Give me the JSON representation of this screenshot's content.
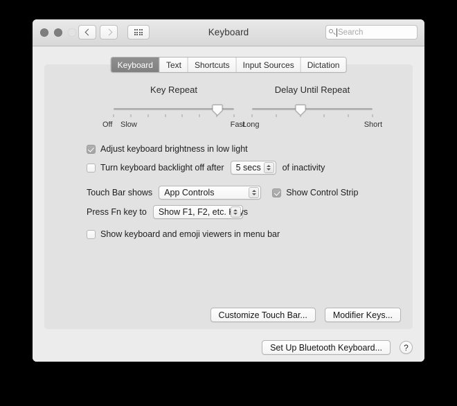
{
  "window": {
    "title": "Keyboard",
    "traffic_lights": [
      "close",
      "minimize",
      "zoom"
    ],
    "nav": {
      "back": "back-chevron",
      "forward": "forward-chevron",
      "show_all": "grid-icon"
    },
    "search": {
      "placeholder": "Search",
      "value": "",
      "icon": "search-icon"
    }
  },
  "tabs": [
    {
      "label": "Keyboard",
      "active": true
    },
    {
      "label": "Text",
      "active": false
    },
    {
      "label": "Shortcuts",
      "active": false
    },
    {
      "label": "Input Sources",
      "active": false
    },
    {
      "label": "Dictation",
      "active": false
    }
  ],
  "sliders": [
    {
      "title": "Key Repeat",
      "left_label": "Off",
      "second_label": "Slow",
      "right_label": "Fast",
      "ticks": 8,
      "value_percent": 86
    },
    {
      "title": "Delay Until Repeat",
      "left_label": "Long",
      "right_label": "Short",
      "ticks": 6,
      "value_percent": 40
    }
  ],
  "options": {
    "adjust_brightness": {
      "label": "Adjust keyboard brightness in low light",
      "checked": true
    },
    "backlight_off": {
      "label": "Turn keyboard backlight off after",
      "checked": false,
      "value": "5 secs",
      "suffix": "of inactivity"
    },
    "touch_bar_shows": {
      "label": "Touch Bar shows",
      "value": "App Controls"
    },
    "show_control_strip": {
      "label": "Show Control Strip",
      "checked": true
    },
    "press_fn_key": {
      "label": "Press Fn key to",
      "value": "Show F1, F2, etc. Keys"
    },
    "show_viewers": {
      "label": "Show keyboard and emoji viewers in menu bar",
      "checked": false
    }
  },
  "buttons": {
    "customize_touch_bar": "Customize Touch Bar...",
    "modifier_keys": "Modifier Keys...",
    "setup_bluetooth": "Set Up Bluetooth Keyboard...",
    "help": "?"
  },
  "colors": {
    "window_bg": "#ececec",
    "panel_bg": "#e2e2e2",
    "titlebar_top": "#e9e9e9",
    "titlebar_bottom": "#d8d8d8",
    "active_tab": "#868686",
    "text": "#1e1e1e"
  }
}
